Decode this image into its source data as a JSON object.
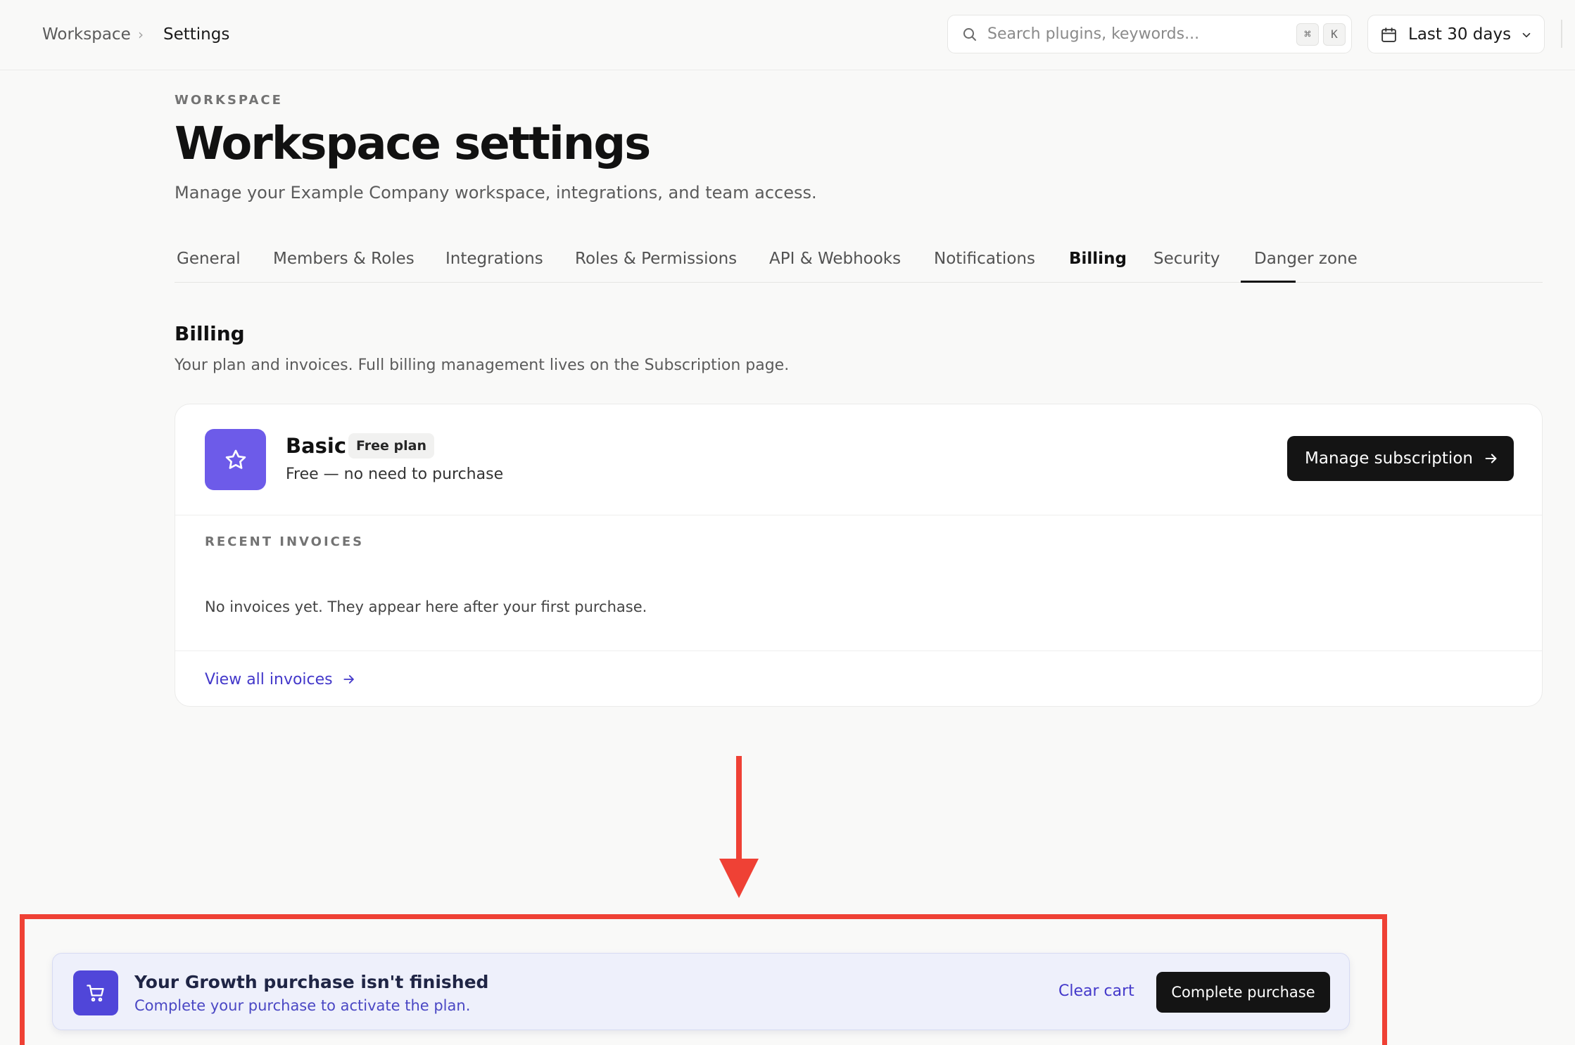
{
  "breadcrumb": {
    "root": "Workspace",
    "separator": "›",
    "current": "Settings"
  },
  "search": {
    "placeholder": "Search plugins, keywords...",
    "value": "",
    "shortcut_mod": "⌘",
    "shortcut_key": "K"
  },
  "date_range": {
    "label": "Last 30 days"
  },
  "header": {
    "eyebrow": "WORKSPACE",
    "title": "Workspace settings",
    "subtitle": "Manage your Example Company workspace, integrations, and team access."
  },
  "tabs": [
    {
      "label": "General"
    },
    {
      "label": "Members & Roles"
    },
    {
      "label": "Integrations"
    },
    {
      "label": "Roles & Permissions"
    },
    {
      "label": "API & Webhooks"
    },
    {
      "label": "Notifications"
    },
    {
      "label": "Billing"
    },
    {
      "label": "Security"
    },
    {
      "label": "Danger zone"
    }
  ],
  "active_tab": "Billing",
  "billing": {
    "title": "Billing",
    "description": "Your plan and invoices. Full billing management lives on the Subscription page.",
    "plan": {
      "icon": "star-icon",
      "name": "Basic",
      "badge": "Free plan",
      "description": "Free — no need to purchase"
    },
    "manage_button": "Manage subscription",
    "invoices_label": "RECENT INVOICES",
    "invoices_empty": "No invoices yet. They appear here after your first purchase.",
    "view_all": "View all invoices"
  },
  "cart_banner": {
    "icon": "cart-icon",
    "title": "Your Growth purchase isn't finished",
    "subtitle": "Complete your purchase to activate the plan.",
    "clear_label": "Clear cart",
    "complete_label": "Complete purchase"
  },
  "colors": {
    "accent": "#6d5be9",
    "link": "#4338ca",
    "primary_button": "#141414",
    "annotation": "#ef4135",
    "banner_bg": "#eef0fb"
  }
}
